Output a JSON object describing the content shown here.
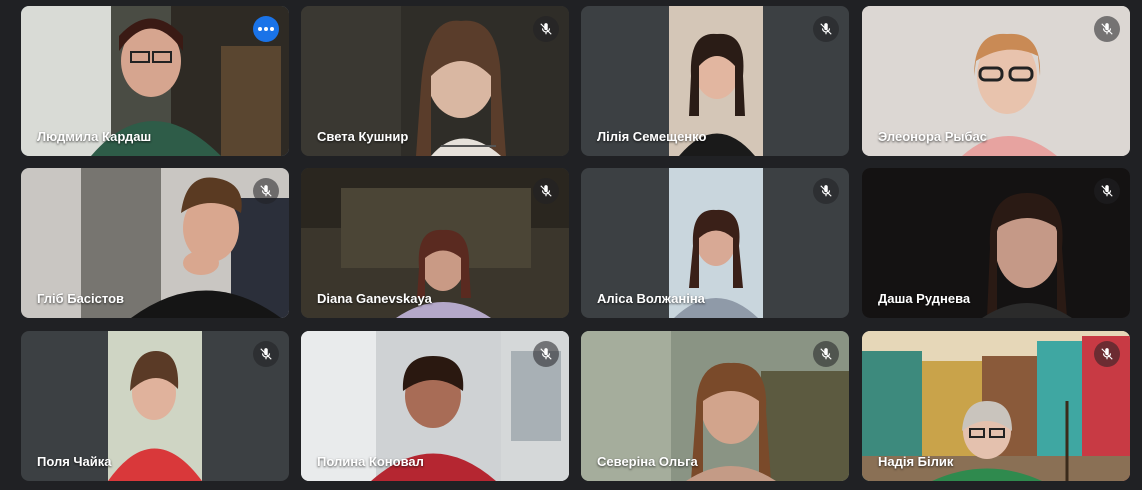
{
  "participants": [
    {
      "name": "Людмила Кардаш",
      "muted": false
    },
    {
      "name": "Света Кушнир",
      "muted": true
    },
    {
      "name": "Лілія Семещенко",
      "muted": true
    },
    {
      "name": "Элеонора Рыбас",
      "muted": true
    },
    {
      "name": "Гліб Басістов",
      "muted": true
    },
    {
      "name": "Diana Ganevskaya",
      "muted": true
    },
    {
      "name": "Аліса Волжаніна",
      "muted": true
    },
    {
      "name": "Даша Руднева",
      "muted": true
    },
    {
      "name": "Поля Чайка",
      "muted": true
    },
    {
      "name": "Полина Коновал",
      "muted": true
    },
    {
      "name": "Северіна Ольга",
      "muted": true
    },
    {
      "name": "Надія Білик",
      "muted": true
    }
  ],
  "icons": {
    "mute": "mic-off-icon",
    "more": "more-options-icon"
  },
  "colors": {
    "background": "#202124",
    "tile": "#3c4043",
    "active_border": "#8ab4f8",
    "more_button": "#1a73e8"
  }
}
